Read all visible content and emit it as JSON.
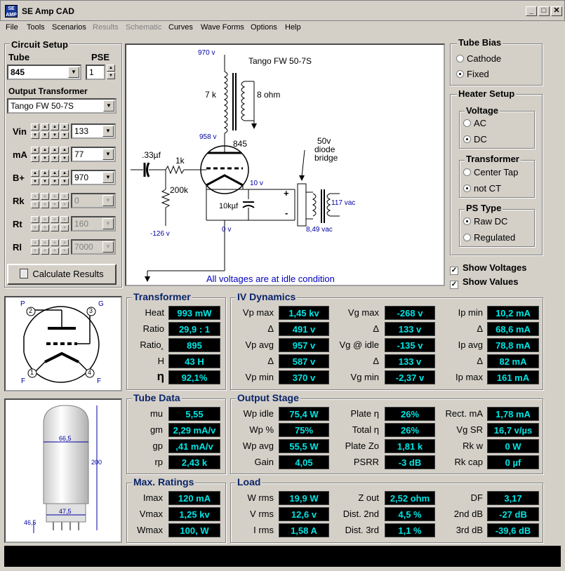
{
  "window": {
    "title": "SE Amp CAD",
    "icon_text": "SE AMP"
  },
  "menu": [
    "File",
    "Tools",
    "Scenarios",
    "Results",
    "Schematic",
    "Curves",
    "Wave Forms",
    "Options",
    "Help"
  ],
  "circuit_setup": {
    "title": "Circuit Setup",
    "tube_label": "Tube",
    "tube_value": "845",
    "pse_label": "PSE",
    "pse_value": "1",
    "ot_label": "Output Transformer",
    "ot_value": "Tango FW 50-7S",
    "params": [
      {
        "label": "Vin",
        "value": "133",
        "enabled": true
      },
      {
        "label": "mA",
        "value": "77",
        "enabled": true
      },
      {
        "label": "B+",
        "value": "970",
        "enabled": true
      },
      {
        "label": "Rk",
        "value": "0",
        "enabled": false
      },
      {
        "label": "Rt",
        "value": "160",
        "enabled": false
      },
      {
        "label": "Rl",
        "value": "7000",
        "enabled": false
      }
    ],
    "calc_button": "Calculate Results"
  },
  "schematic": {
    "v_970": "970 v",
    "ot_name": "Tango FW 50-7S",
    "r_primary": "7 k",
    "r_secondary": "8 ohm",
    "v_958": "958 v",
    "tube": "845",
    "cap_in": ".33µf",
    "r_grid": "1k",
    "r_bias": "200k",
    "v_neg": "-126 v",
    "v_10": "10 v",
    "cap_fil": "10kµf",
    "v_0": "0 v",
    "bridge_1": "50v",
    "bridge_2": "diode",
    "bridge_3": "bridge",
    "vac_117": "117 vac",
    "vac_849": "8,49 vac",
    "plus": "+",
    "minus": "-",
    "footer": "All voltages are at idle condition"
  },
  "tube_bias": {
    "title": "Tube Bias",
    "options": [
      "Cathode",
      "Fixed"
    ],
    "selected": 1
  },
  "heater": {
    "title": "Heater Setup",
    "voltage": {
      "title": "Voltage",
      "options": [
        "AC",
        "DC"
      ],
      "selected": 1
    },
    "transformer": {
      "title": "Transformer",
      "options": [
        "Center Tap",
        "not CT"
      ],
      "selected": 1
    },
    "ps_type": {
      "title": "PS Type",
      "options": [
        "Raw DC",
        "Regulated"
      ],
      "selected": 0
    }
  },
  "show": {
    "voltages": "Show Voltages",
    "values": "Show Values"
  },
  "pin_diagram": {
    "p": "P",
    "g": "G",
    "f1": "F",
    "f2": "F",
    "n2": "2",
    "n3": "3",
    "n1": "1",
    "n4": "4"
  },
  "tube_drawing": {
    "d1": "66,5",
    "d2": "200",
    "d3": "47,5",
    "d4": "46,5"
  },
  "transformer_panel": {
    "title": "Transformer",
    "rows": [
      {
        "label": "Heat",
        "value": "993 mW"
      },
      {
        "label": "Ratio",
        "value": "29,9 : 1"
      },
      {
        "label": "Ratio˛",
        "value": "895"
      },
      {
        "label": "H",
        "value": "43 H"
      },
      {
        "label": "η",
        "value": "92,1%"
      }
    ]
  },
  "iv_dynamics": {
    "title": "IV Dynamics",
    "col1": [
      {
        "label": "Vp max",
        "value": "1,45 kv"
      },
      {
        "label": "Δ",
        "value": "491 v"
      },
      {
        "label": "Vp avg",
        "value": "957 v"
      },
      {
        "label": "Δ",
        "value": "587 v"
      },
      {
        "label": "Vp min",
        "value": "370 v"
      }
    ],
    "col2": [
      {
        "label": "Vg max",
        "value": "-268 v"
      },
      {
        "label": "Δ",
        "value": "133 v"
      },
      {
        "label": "Vg @ idle",
        "value": "-135 v"
      },
      {
        "label": "Δ",
        "value": "133 v"
      },
      {
        "label": "Vg min",
        "value": "-2,37 v"
      }
    ],
    "col3": [
      {
        "label": "Ip min",
        "value": "10,2 mA"
      },
      {
        "label": "Δ",
        "value": "68,6 mA"
      },
      {
        "label": "Ip avg",
        "value": "78,8 mA"
      },
      {
        "label": "Δ",
        "value": "82 mA"
      },
      {
        "label": "Ip max",
        "value": "161 mA"
      }
    ]
  },
  "tube_data": {
    "title": "Tube Data",
    "rows": [
      {
        "label": "mu",
        "value": "5,55"
      },
      {
        "label": "gm",
        "value": "2,29 mA/v"
      },
      {
        "label": "gp",
        "value": ",41 mA/v"
      },
      {
        "label": "rp",
        "value": "2,43 k"
      }
    ]
  },
  "output_stage": {
    "title": "Output Stage",
    "col1": [
      {
        "label": "Wp idle",
        "value": "75,4 W"
      },
      {
        "label": "Wp %",
        "value": "75%"
      },
      {
        "label": "Wp avg",
        "value": "55,5 W"
      },
      {
        "label": "Gain",
        "value": "4,05"
      }
    ],
    "col2": [
      {
        "label": "Plate η",
        "value": "26%"
      },
      {
        "label": "Total η",
        "value": "26%"
      },
      {
        "label": "Plate Zo",
        "value": "1,81 k"
      },
      {
        "label": "PSRR",
        "value": "-3 dB"
      }
    ],
    "col3": [
      {
        "label": "Rect. mA",
        "value": "1,78 mA"
      },
      {
        "label": "Vg SR",
        "value": "16,7 v/µs"
      },
      {
        "label": "Rk w",
        "value": "0 W"
      },
      {
        "label": "Rk cap",
        "value": "0 µf"
      }
    ]
  },
  "max_ratings": {
    "title": "Max. Ratings",
    "rows": [
      {
        "label": "Imax",
        "value": "120 mA"
      },
      {
        "label": "Vmax",
        "value": "1,25 kv"
      },
      {
        "label": "Wmax",
        "value": "100, W"
      }
    ]
  },
  "load": {
    "title": "Load",
    "col1": [
      {
        "label": "W rms",
        "value": "19,9 W"
      },
      {
        "label": "V rms",
        "value": "12,6 v"
      },
      {
        "label": "I rms",
        "value": "1,58 A"
      }
    ],
    "col2": [
      {
        "label": "Z out",
        "value": "2,52 ohm"
      },
      {
        "label": "Dist. 2nd",
        "value": "4,5 %"
      },
      {
        "label": "Dist. 3rd",
        "value": "1,1 %"
      }
    ],
    "col3": [
      {
        "label": "DF",
        "value": "3,17"
      },
      {
        "label": "2nd dB",
        "value": "-27 dB"
      },
      {
        "label": "3rd dB",
        "value": "-39,6 dB"
      }
    ]
  }
}
